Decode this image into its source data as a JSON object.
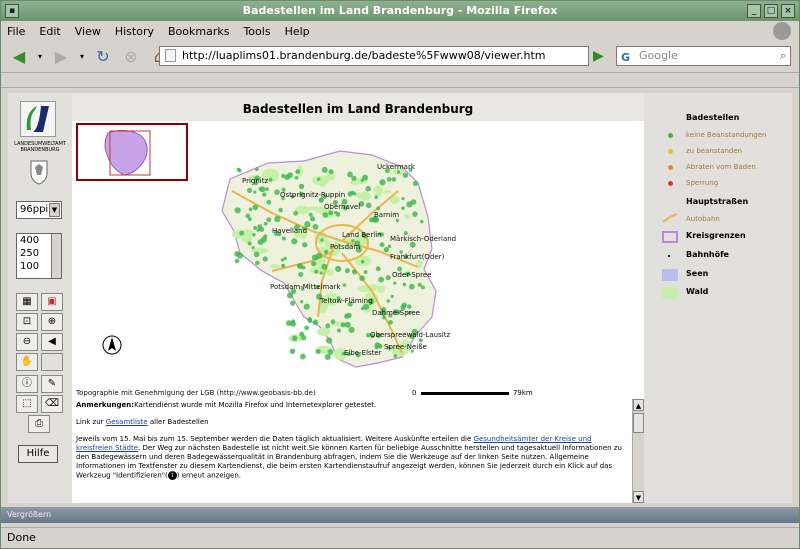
{
  "window": {
    "title": "Badestellen im Land Brandenburg - Mozilla Firefox"
  },
  "menu": [
    "File",
    "Edit",
    "View",
    "History",
    "Bookmarks",
    "Tools",
    "Help"
  ],
  "nav": {
    "url": "http://luaplims01.brandenburg.de/badeste%5Fwww08/viewer.htm",
    "search_placeholder": "Google"
  },
  "left": {
    "logo_text": "LANDESUMWELTAMT BRANDENBURG",
    "resolution": "96ppi",
    "scales": [
      "400",
      "250",
      "100"
    ],
    "help_label": "Hilfe"
  },
  "map": {
    "title": "Badestellen im Land Brandenburg",
    "copyright": "Topographie mit Genehmigung der LGB (http://www.geobasis-bb.de)",
    "scale_start": "0",
    "scale_end": "79km",
    "places": [
      "Prignitz",
      "Uckermark",
      "Ostprignitz-Ruppin",
      "Oberhavel",
      "Barnim",
      "Havelland",
      "Märkisch-Oderland",
      "Land Berlin",
      "Potsdam",
      "Frankfurt(Oder)",
      "Potsdam-Mittelmark",
      "Oder-Spree",
      "Teltow-Fläming",
      "Dahme-Spree",
      "Oberspreewald-Lausitz",
      "Spree-Neiße",
      "Elbe-Elster"
    ]
  },
  "info": {
    "anmerk_label": "Anmerkungen:",
    "anmerk_text": "Kartendienst wurde mit Mozilla Firefox und Internetexplorer getestet.",
    "link_pre": "Link zur ",
    "link_text": "Gesamtliste",
    "link_post": " aller Badestellen",
    "para1_pre": "Jeweils vom 15. Mai bis zum 15. September werden die Daten täglich aktualisiert. Weitere Auskünfte erteilen die ",
    "para1_link": "Gesundheitsämter der Kreise und kreisfreien Städte",
    "para1_post": ". Der Weg zur nächsten Badestelle ist nicht weit.Sie können Karten für beliebige Ausschnitte herstellen und tagesaktuell Informationen zu den Badegewässern und deren Badegewässerqualität in Brandenburg abfragen, indem Sie die Werkzeuge auf der linken Seite nutzen. Allgemeine Informationen im Textfenster zu diesem Kartendienst, die beim ersten Kartendienstaufruf angezeigt werden, können Sie jederzeit durch ein Klick auf das Werkzeug \"Identifizieren\"(",
    "para1_end": ") erneut anzeigen."
  },
  "legend": {
    "badestellen_title": "Badestellen",
    "badestellen_items": [
      {
        "label": "keine Beanstandungen",
        "color": "#3cb44b"
      },
      {
        "label": "zu beanstanden",
        "color": "#e6c229"
      },
      {
        "label": "Abraten vom Baden",
        "color": "#e08a2c"
      },
      {
        "label": "Sperrung",
        "color": "#d63a3a"
      }
    ],
    "hauptstrassen_title": "Hauptstraßen",
    "autobahn": "Autobahn",
    "kreisgrenzen": "Kreisgrenzen",
    "bahnhoefe": "Bahnhöfe",
    "seen": "Seen",
    "wald": "Wald"
  },
  "bottom": {
    "bluebar": "Vergrößern",
    "status": "Done"
  }
}
